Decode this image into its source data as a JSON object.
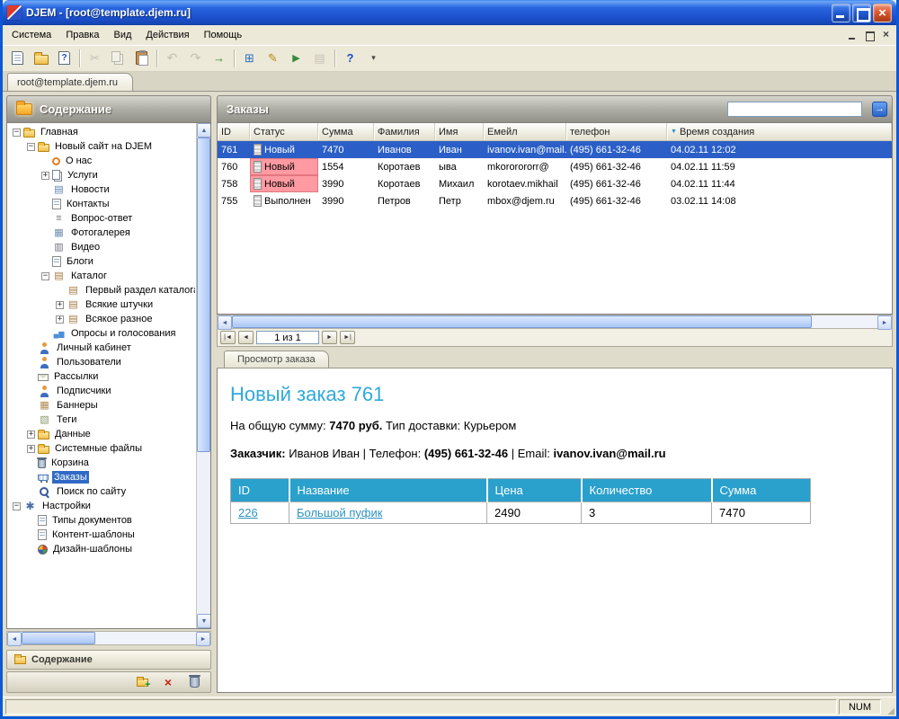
{
  "window": {
    "title": "DJEM - [root@template.djem.ru]"
  },
  "menubar": {
    "items": [
      {
        "label": "Система"
      },
      {
        "label": "Правка"
      },
      {
        "label": "Вид"
      },
      {
        "label": "Действия"
      },
      {
        "label": "Помощь"
      }
    ]
  },
  "toolbar": {
    "buttons": [
      {
        "name": "new-document-button",
        "kind": "page"
      },
      {
        "name": "open-button",
        "kind": "folder"
      },
      {
        "name": "document-help-button",
        "kind": "helpdoc"
      },
      {
        "kind": "sep"
      },
      {
        "name": "cut-button",
        "kind": "scissors",
        "disabled": true
      },
      {
        "name": "copy-button",
        "kind": "copy",
        "disabled": true
      },
      {
        "name": "paste-button",
        "kind": "paste"
      },
      {
        "kind": "sep"
      },
      {
        "name": "undo-button",
        "kind": "undo",
        "disabled": true
      },
      {
        "name": "redo-button",
        "kind": "redo",
        "disabled": true
      },
      {
        "name": "export-button",
        "kind": "export"
      },
      {
        "kind": "sep"
      },
      {
        "name": "properties-button",
        "kind": "props"
      },
      {
        "name": "edit-button",
        "kind": "edit"
      },
      {
        "name": "publish-button",
        "kind": "publish"
      },
      {
        "name": "print-button",
        "kind": "print",
        "disabled": true
      },
      {
        "kind": "sep"
      },
      {
        "name": "help-button",
        "kind": "help"
      },
      {
        "name": "toolbar-options-button",
        "kind": "caret"
      }
    ]
  },
  "tabstrip": {
    "main_tab": "root@template.djem.ru"
  },
  "sidebar": {
    "header": {
      "title": "Содержание"
    },
    "tree": [
      {
        "label": "Главная",
        "level": 0,
        "expander": "minus",
        "icon": "folder"
      },
      {
        "label": "Новый сайт на DJEM",
        "level": 1,
        "expander": "minus",
        "icon": "folder"
      },
      {
        "label": "О нас",
        "level": 2,
        "expander": "none",
        "icon": "circle"
      },
      {
        "label": "Услуги",
        "level": 2,
        "expander": "plus",
        "icon": "pages"
      },
      {
        "label": "Новости",
        "level": 2,
        "expander": "none",
        "icon": "news"
      },
      {
        "label": "Контакты",
        "level": 2,
        "expander": "none",
        "icon": "page"
      },
      {
        "label": "Вопрос-ответ",
        "level": 2,
        "expander": "none",
        "icon": "list"
      },
      {
        "label": "Фотогалерея",
        "level": 2,
        "expander": "none",
        "icon": "grid"
      },
      {
        "label": "Видео",
        "level": 2,
        "expander": "none",
        "icon": "film"
      },
      {
        "label": "Блоги",
        "level": 2,
        "expander": "none",
        "icon": "page"
      },
      {
        "label": "Каталог",
        "level": 2,
        "expander": "minus",
        "icon": "catalog"
      },
      {
        "label": "Первый раздел каталога",
        "level": 3,
        "expander": "none",
        "icon": "catalog"
      },
      {
        "label": "Всякие штучки",
        "level": 3,
        "expander": "plus",
        "icon": "catalog"
      },
      {
        "label": "Всякое разное",
        "level": 3,
        "expander": "plus",
        "icon": "catalog"
      },
      {
        "label": "Опросы и голосования",
        "level": 2,
        "expander": "none",
        "icon": "chart"
      },
      {
        "label": "Личный кабинет",
        "level": 1,
        "expander": "none",
        "icon": "person"
      },
      {
        "label": "Пользователи",
        "level": 1,
        "expander": "none",
        "icon": "person"
      },
      {
        "label": "Рассылки",
        "level": 1,
        "expander": "none",
        "icon": "mail"
      },
      {
        "label": "Подписчики",
        "level": 1,
        "expander": "none",
        "icon": "person"
      },
      {
        "label": "Баннеры",
        "level": 1,
        "expander": "none",
        "icon": "banner"
      },
      {
        "label": "Теги",
        "level": 1,
        "expander": "none",
        "icon": "tags"
      },
      {
        "label": "Данные",
        "level": 1,
        "expander": "plus",
        "icon": "folder"
      },
      {
        "label": "Системные файлы",
        "level": 1,
        "expander": "plus",
        "icon": "folder"
      },
      {
        "label": "Корзина",
        "level": 1,
        "expander": "none",
        "icon": "trash"
      },
      {
        "label": "Заказы",
        "level": 1,
        "expander": "none",
        "icon": "cart",
        "selected": true
      },
      {
        "label": "Поиск по сайту",
        "level": 1,
        "expander": "none",
        "icon": "search"
      },
      {
        "label": "Настройки",
        "level": 0,
        "expander": "minus",
        "icon": "gear"
      },
      {
        "label": "Типы документов",
        "level": 1,
        "expander": "none",
        "icon": "page"
      },
      {
        "label": "Контент-шаблоны",
        "level": 1,
        "expander": "none",
        "icon": "page"
      },
      {
        "label": "Дизайн-шаблоны",
        "level": 1,
        "expander": "none",
        "icon": "palette"
      }
    ],
    "footer": {
      "title": "Содержание"
    }
  },
  "orders": {
    "title": "Заказы",
    "search_value": "",
    "columns": [
      {
        "label": "ID"
      },
      {
        "label": "Статус"
      },
      {
        "label": "Сумма"
      },
      {
        "label": "Фамилия"
      },
      {
        "label": "Имя"
      },
      {
        "label": "Емейл"
      },
      {
        "label": "телефон"
      },
      {
        "label": "Время создания",
        "sorted": true
      }
    ],
    "rows": [
      {
        "id": "761",
        "status": "Новый",
        "sum": "7470",
        "lastname": "Иванов",
        "firstname": "Иван",
        "email": "ivanov.ivan@mail.ru",
        "phone": "(495) 661-32-46",
        "created": "04.02.11 12:02",
        "selected": true,
        "status_highlight": false
      },
      {
        "id": "760",
        "status": "Новый",
        "sum": "1554",
        "lastname": "Коротаев",
        "firstname": "ыва",
        "email": "mkororororr@",
        "phone": "(495) 661-32-46",
        "created": "04.02.11 11:59",
        "selected": false,
        "status_highlight": true
      },
      {
        "id": "758",
        "status": "Новый",
        "sum": "3990",
        "lastname": "Коротаев",
        "firstname": "Михаил",
        "email": "korotaev.mikhail",
        "phone": "(495) 661-32-46",
        "created": "04.02.11 11:44",
        "selected": false,
        "status_highlight": true
      },
      {
        "id": "755",
        "status": "Выполнен",
        "sum": "3990",
        "lastname": "Петров",
        "firstname": "Петр",
        "email": "mbox@djem.ru",
        "phone": "(495) 661-32-46",
        "created": "03.02.11 14:08",
        "selected": false,
        "status_highlight": false
      }
    ],
    "pagination": {
      "label": "1 из 1"
    }
  },
  "detail": {
    "tab": "Просмотр заказа",
    "title": "Новый заказ 761",
    "total_label": "На общую сумму:",
    "total_value": "7470 руб.",
    "delivery_label": "Тип доставки:",
    "delivery_value": "Курьером",
    "customer_label": "Заказчик:",
    "customer_name": "Иванов Иван",
    "sep": "|",
    "phone_label": "Телефон:",
    "phone_value": "(495) 661-32-46",
    "email_label": "Email:",
    "email_value": "ivanov.ivan@mail.ru",
    "items_table": {
      "columns": [
        "ID",
        "Название",
        "Цена",
        "Количество",
        "Сумма"
      ],
      "rows": [
        {
          "id": "226",
          "name": "Большой пуфик",
          "price": "2490",
          "qty": "3",
          "sum": "7470"
        }
      ]
    }
  },
  "statusbar": {
    "num": "NUM"
  },
  "colors": {
    "selection": "#316AC5",
    "status_new_highlight": "#FF9AA2",
    "detail_table_header": "#2AA0CC",
    "link": "#2E93BE",
    "detail_title": "#2FA9DC",
    "titlebar_blue": "#1C50CC"
  }
}
